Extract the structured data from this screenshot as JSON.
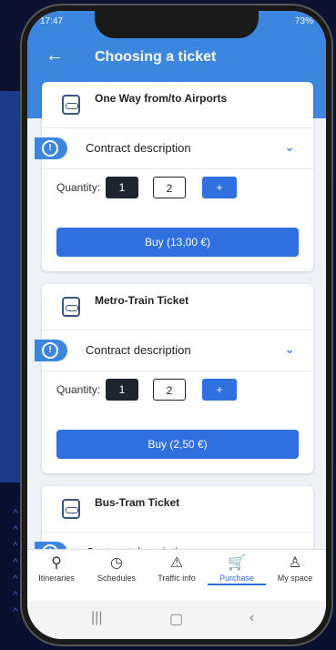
{
  "status": {
    "time": "17:47",
    "battery": "73%"
  },
  "header": {
    "title": "Choosing a ticket",
    "back_icon": "←"
  },
  "tickets": [
    {
      "title": "One Way from/to Airports",
      "contract": "Contract description",
      "quantity_label": "Quantity:",
      "q1": "1",
      "q2": "2",
      "plus": "+",
      "buy_label": "Buy (13,00 €)"
    },
    {
      "title": "Metro-Train Ticket",
      "contract": "Contract description",
      "quantity_label": "Quantity:",
      "q1": "1",
      "q2": "2",
      "plus": "+",
      "buy_label": "Buy (2,50 €)"
    },
    {
      "title": "Bus-Tram Ticket",
      "contract": "Contract description"
    }
  ],
  "tabs": [
    {
      "label": "Itineraries",
      "icon": "⚲"
    },
    {
      "label": "Schedules",
      "icon": "◷"
    },
    {
      "label": "Traffic info",
      "icon": "⚠"
    },
    {
      "label": "Purchase",
      "icon": "🛒"
    },
    {
      "label": "My space",
      "icon": "♙"
    }
  ],
  "android_nav": {
    "recent": "|||",
    "home": "▢",
    "back": "‹"
  },
  "colors": {
    "primary": "#2f6fe0",
    "header": "#3d86df",
    "dark_qty": "#1e2430"
  }
}
